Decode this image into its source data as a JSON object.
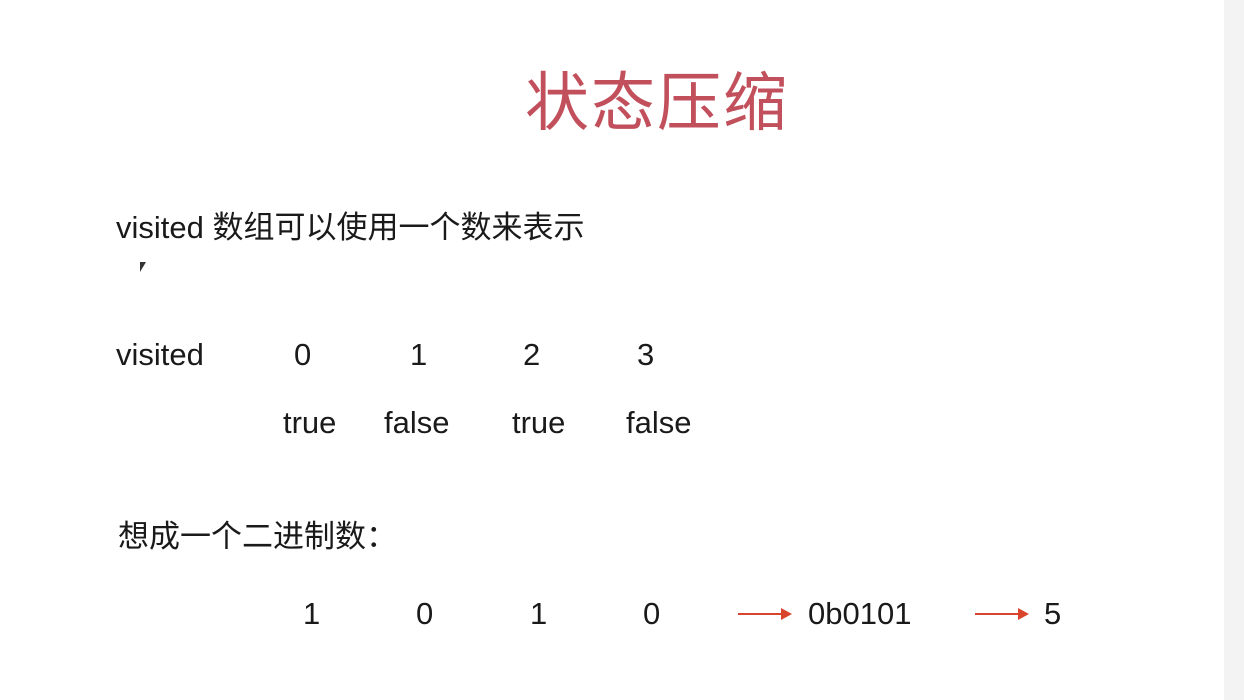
{
  "slide": {
    "title": "状态压缩",
    "subtitle": "visited 数组可以使用一个数来表示",
    "visited_row": {
      "label": "visited",
      "indices": [
        "0",
        "1",
        "2",
        "3"
      ],
      "values": [
        "true",
        "false",
        "true",
        "false"
      ]
    },
    "binary_label": "想成一个二进制数：",
    "bits": [
      "1",
      "0",
      "1",
      "0"
    ],
    "binary_value": "0b0101",
    "decimal_value": "5",
    "colors": {
      "title": "#c2505c",
      "arrow": "#d9452c",
      "text": "#1a1a1a"
    }
  }
}
